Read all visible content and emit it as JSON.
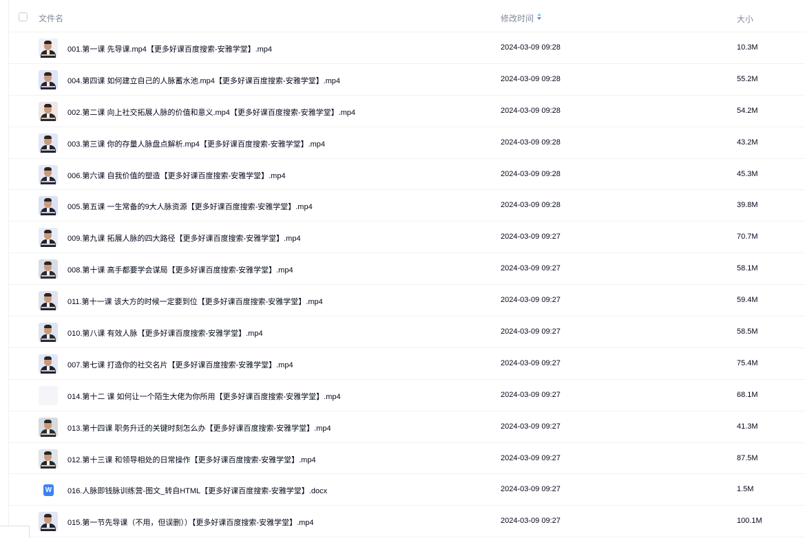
{
  "header": {
    "name_label": "文件名",
    "time_label": "修改时间",
    "size_label": "大小",
    "sort_icon": "sort-toggle-icon"
  },
  "files": [
    {
      "name": "001.第一课 先导课.mp4【更多好课百度搜索-安雅学堂】.mp4",
      "time": "2024-03-09 09:28",
      "size": "10.3M",
      "icon": "video-thumbnail"
    },
    {
      "name": "004.第四课 如何建立自己的人脉蓄水池.mp4【更多好课百度搜索-安雅学堂】.mp4",
      "time": "2024-03-09 09:28",
      "size": "55.2M",
      "icon": "video-thumbnail"
    },
    {
      "name": "002.第二课 向上社交拓展人脉的价值和意义.mp4【更多好课百度搜索-安雅学堂】.mp4",
      "time": "2024-03-09 09:28",
      "size": "54.2M",
      "icon": "video-thumbnail"
    },
    {
      "name": "003.第三课 你的存量人脉盘点解析.mp4【更多好课百度搜索-安雅学堂】.mp4",
      "time": "2024-03-09 09:28",
      "size": "43.2M",
      "icon": "video-thumbnail"
    },
    {
      "name": "006.第六课 自我价值的塑造【更多好课百度搜索-安雅学堂】.mp4",
      "time": "2024-03-09 09:28",
      "size": "45.3M",
      "icon": "video-thumbnail"
    },
    {
      "name": "005.第五课 一生常备的9大人脉资源【更多好课百度搜索-安雅学堂】.mp4",
      "time": "2024-03-09 09:28",
      "size": "39.8M",
      "icon": "video-thumbnail"
    },
    {
      "name": "009.第九课 拓展人脉的四大路径【更多好课百度搜索-安雅学堂】.mp4",
      "time": "2024-03-09 09:27",
      "size": "70.7M",
      "icon": "video-thumbnail"
    },
    {
      "name": "008.第十课 高手都要学会谋局【更多好课百度搜索-安雅学堂】.mp4",
      "time": "2024-03-09 09:27",
      "size": "58.1M",
      "icon": "video-thumbnail"
    },
    {
      "name": "011.第十一课 该大方的时候一定要到位【更多好课百度搜索-安雅学堂】.mp4",
      "time": "2024-03-09 09:27",
      "size": "59.4M",
      "icon": "video-thumbnail"
    },
    {
      "name": "010.第八课 有效人脉【更多好课百度搜索-安雅学堂】.mp4",
      "time": "2024-03-09 09:27",
      "size": "58.5M",
      "icon": "video-thumbnail"
    },
    {
      "name": "007.第七课 打造你的社交名片【更多好课百度搜索-安雅学堂】.mp4",
      "time": "2024-03-09 09:27",
      "size": "75.4M",
      "icon": "video-thumbnail"
    },
    {
      "name": "014.第十二 课 如何让一个陌生大佬为你所用【更多好课百度搜索-安雅学堂】.mp4",
      "time": "2024-03-09 09:27",
      "size": "68.1M",
      "icon": "blank-thumbnail"
    },
    {
      "name": "013.第十四课 职务升迁的关键时刻怎么办【更多好课百度搜索-安雅学堂】.mp4",
      "time": "2024-03-09 09:27",
      "size": "41.3M",
      "icon": "video-thumbnail"
    },
    {
      "name": "012.第十三课 和领导相处的日常操作【更多好课百度搜索-安雅学堂】.mp4",
      "time": "2024-03-09 09:27",
      "size": "87.5M",
      "icon": "video-thumbnail"
    },
    {
      "name": "016.人脉即钱脉训练营-图文_转自HTML【更多好课百度搜索-安雅学堂】.docx",
      "time": "2024-03-09 09:27",
      "size": "1.5M",
      "icon": "word-doc-icon",
      "icon_glyph": "W"
    },
    {
      "name": "015.第一节先导课（不用，但误删））【更多好课百度搜索-安雅学堂】.mp4",
      "time": "2024-03-09 09:27",
      "size": "100.1M",
      "icon": "video-thumbnail"
    }
  ],
  "colors": {
    "text": "#03081a",
    "header_text": "#818999",
    "divider": "#f1f2f4",
    "doc_icon": "#3b82f6"
  }
}
